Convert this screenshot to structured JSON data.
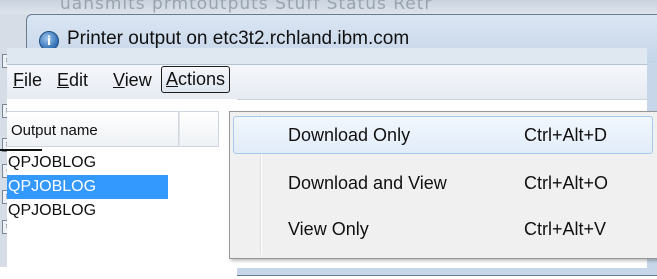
{
  "background": {
    "top_text": "uansmits    prmtoutputs    Stuff Status    Retr"
  },
  "window": {
    "title": "Printer output on etc3t2.rchland.ibm.com",
    "app_icon_glyph": "i"
  },
  "menubar": {
    "items": [
      {
        "label": "File",
        "accel": "F"
      },
      {
        "label": "Edit",
        "accel": "E"
      },
      {
        "label": "View",
        "accel": "V"
      },
      {
        "label": "Actions",
        "accel": "A"
      }
    ]
  },
  "table": {
    "column_header": "Output name",
    "rows": [
      "QPJOBLOG",
      "QPJOBLOG",
      "QPJOBLOG"
    ],
    "selected_row": 1
  },
  "actions_menu": {
    "items": [
      {
        "label": "Download Only",
        "shortcut": "Ctrl+Alt+D"
      },
      {
        "label": "Download and View",
        "shortcut": "Ctrl+Alt+O"
      },
      {
        "label": "View Only",
        "shortcut": "Ctrl+Alt+V"
      }
    ],
    "hovered_index": 0
  },
  "colors": {
    "selection": "#3399ff",
    "hover_border": "#a8c8ec"
  }
}
